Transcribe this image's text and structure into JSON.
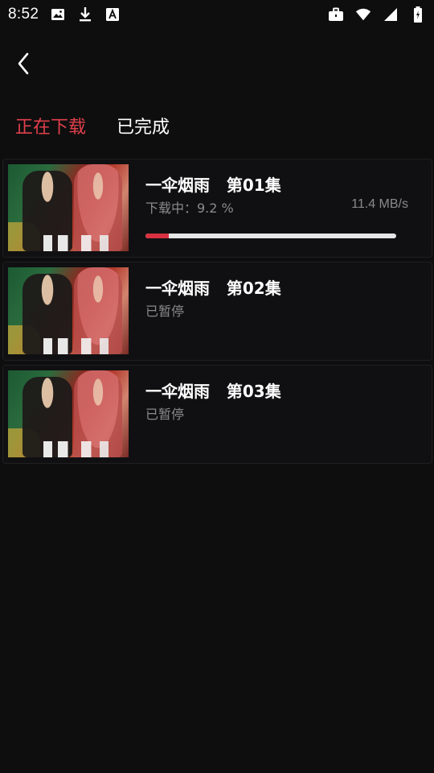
{
  "status_bar": {
    "time": "8:52",
    "icons_left": [
      "image-icon",
      "download-icon",
      "font-a-icon"
    ],
    "icons_right": [
      "briefcase-icon",
      "wifi-icon",
      "signal-icon",
      "battery-icon"
    ]
  },
  "tabs": [
    {
      "label": "正在下载",
      "active": true
    },
    {
      "label": "已完成",
      "active": false
    }
  ],
  "colors": {
    "accent": "#e0404b",
    "progress_fill": "#d8313f",
    "progress_track": "#e6e6e6",
    "background": "#0e0e0f"
  },
  "downloads": [
    {
      "title": "一伞烟雨   第01集",
      "status": "下载中：9.2 %",
      "speed": "11.4 MB/s",
      "progress": 0.092
    },
    {
      "title": "一伞烟雨   第02集",
      "status": "已暂停"
    },
    {
      "title": "一伞烟雨   第03集",
      "status": "已暂停"
    }
  ]
}
